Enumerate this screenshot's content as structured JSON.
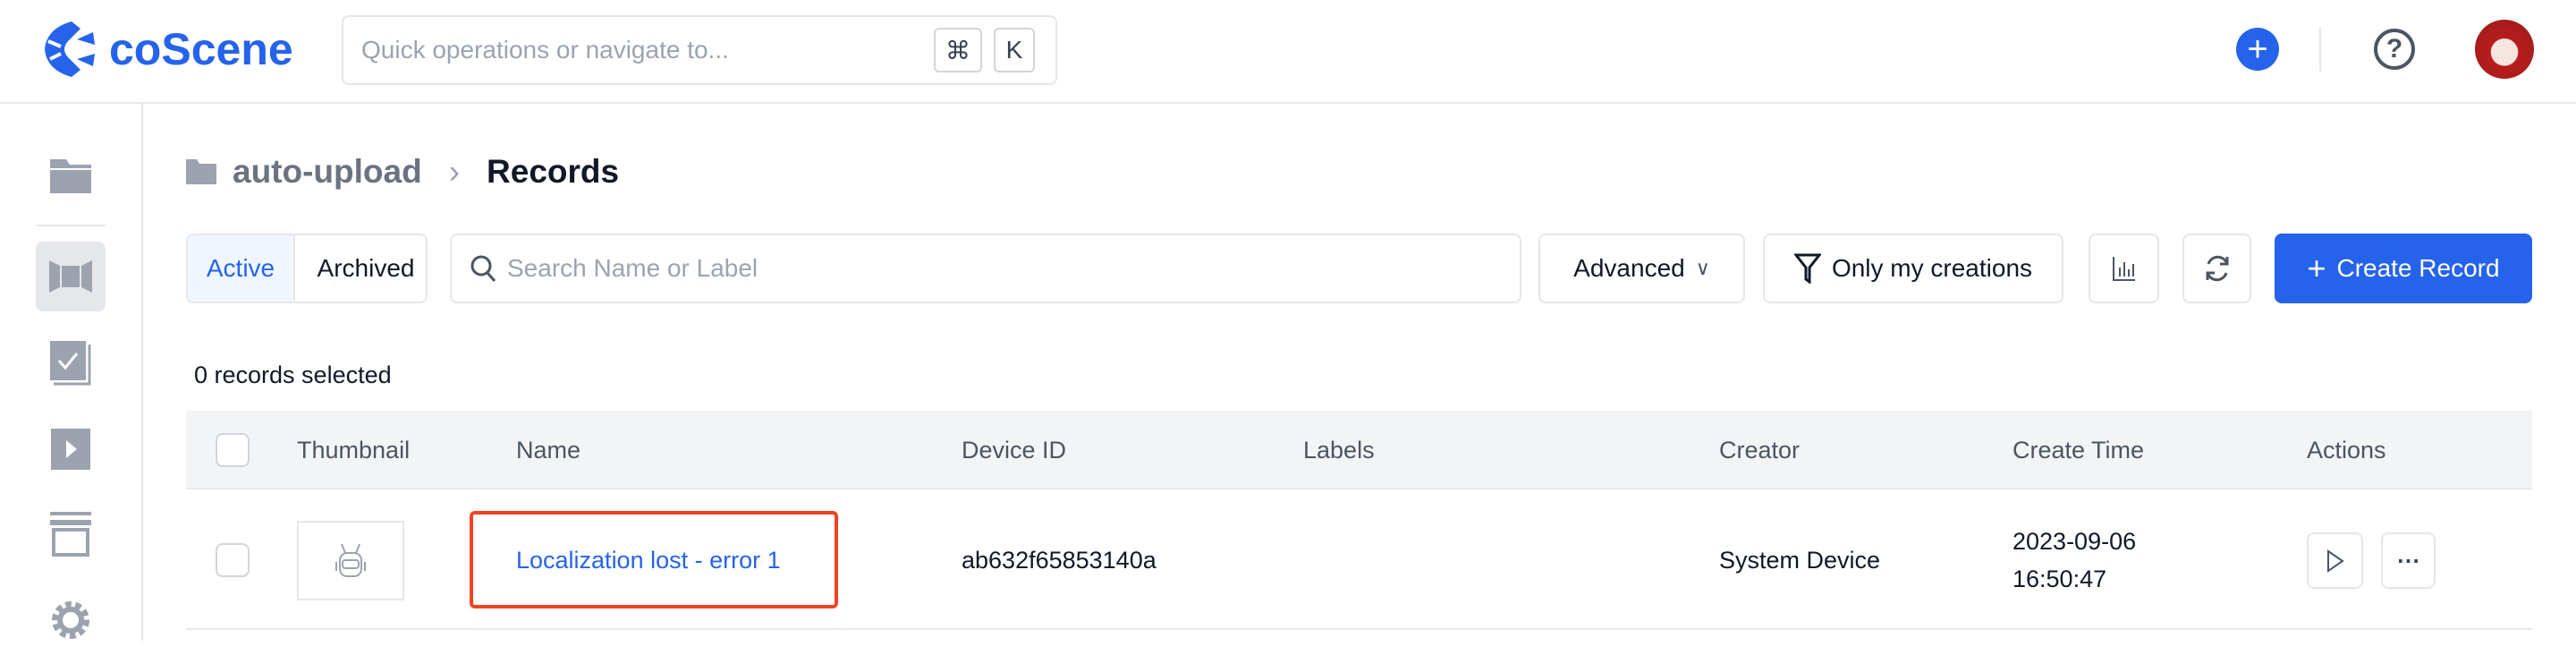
{
  "header": {
    "logo_text": "coScene",
    "quick_search_placeholder": "Quick operations or navigate to...",
    "shortcut_keys": [
      "⌘",
      "K"
    ]
  },
  "sidebar": {
    "items": [
      {
        "icon": "folder-icon"
      },
      {
        "icon": "records-icon",
        "active": true
      },
      {
        "icon": "tasks-icon"
      },
      {
        "icon": "play-icon"
      },
      {
        "icon": "archive-icon"
      },
      {
        "icon": "gear-icon"
      }
    ]
  },
  "breadcrumb": {
    "project": "auto-upload",
    "current": "Records"
  },
  "toolbar": {
    "tabs": [
      {
        "label": "Active",
        "active": true
      },
      {
        "label": "Archived"
      }
    ],
    "search_placeholder": "Search Name or Label",
    "advanced_label": "Advanced",
    "only_mine_label": "Only my creations",
    "create_label": "Create Record"
  },
  "selection_text": "0 records selected",
  "table": {
    "columns": [
      "Thumbnail",
      "Name",
      "Device ID",
      "Labels",
      "Creator",
      "Create Time",
      "Actions"
    ],
    "rows": [
      {
        "name": "Localization lost - error 1",
        "device_id": "ab632f65853140a",
        "labels": "",
        "creator": "System Device",
        "create_date": "2023-09-06",
        "create_time": "16:50:47"
      }
    ]
  },
  "colors": {
    "accent": "#2563eb",
    "highlight": "#ef4423"
  }
}
